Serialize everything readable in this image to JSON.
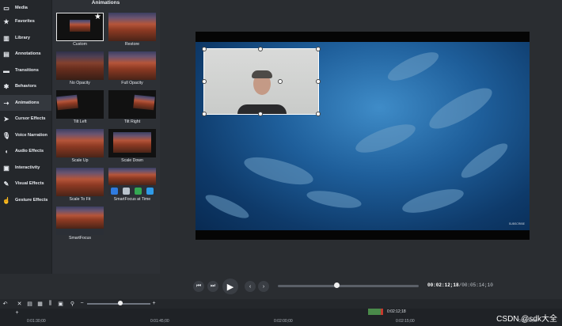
{
  "sidebar": {
    "items": [
      {
        "label": "Media",
        "icon": "media-icon",
        "active": false
      },
      {
        "label": "Favorites",
        "icon": "star-icon",
        "active": false
      },
      {
        "label": "Library",
        "icon": "library-icon",
        "active": false
      },
      {
        "label": "Annotations",
        "icon": "annotations-icon",
        "active": false
      },
      {
        "label": "Transitions",
        "icon": "transitions-icon",
        "active": false
      },
      {
        "label": "Behaviors",
        "icon": "behaviors-icon",
        "active": false
      },
      {
        "label": "Animations",
        "icon": "animations-icon",
        "active": true
      },
      {
        "label": "Cursor Effects",
        "icon": "cursor-icon",
        "active": false
      },
      {
        "label": "Voice Narration",
        "icon": "microphone-icon",
        "active": false
      },
      {
        "label": "Audio Effects",
        "icon": "audio-icon",
        "active": false
      },
      {
        "label": "Interactivity",
        "icon": "interactivity-icon",
        "active": false
      },
      {
        "label": "Visual Effects",
        "icon": "visual-effects-icon",
        "active": false
      },
      {
        "label": "Gesture Effects",
        "icon": "gesture-icon",
        "active": false
      }
    ]
  },
  "panel": {
    "title": "Animations",
    "items": [
      {
        "label": "Custom",
        "selected": true
      },
      {
        "label": "Restore",
        "selected": false
      },
      {
        "label": "No Opacity",
        "selected": false
      },
      {
        "label": "Full Opacity",
        "selected": false
      },
      {
        "label": "Tilt Left",
        "selected": false
      },
      {
        "label": "Tilt Right",
        "selected": false
      },
      {
        "label": "Scale Up",
        "selected": false
      },
      {
        "label": "Scale Down",
        "selected": false
      },
      {
        "label": "Scale To Fit",
        "selected": false
      },
      {
        "label": "SmartFocus at Time",
        "selected": false
      },
      {
        "label": "SmartFocus",
        "selected": false
      }
    ]
  },
  "video": {
    "watermark": "SUBSCRIBE"
  },
  "transport": {
    "timecode_current": "00:02:12;18",
    "timecode_total": "00:05:14;10",
    "progress": 0.42
  },
  "timeline": {
    "ruler": [
      "0:01:30;00",
      "0:01:45;00",
      "0:02:00;00",
      "0:02:15;00",
      "0:02:30;00"
    ],
    "playhead_time": "0:02:12;18",
    "zoom": 0.52
  },
  "watermark": "CSDN @sdk大全",
  "colors": {
    "accent": "#2f9be8",
    "playhead_green": "#4a8a4a",
    "playhead_red": "#c43a2f"
  }
}
